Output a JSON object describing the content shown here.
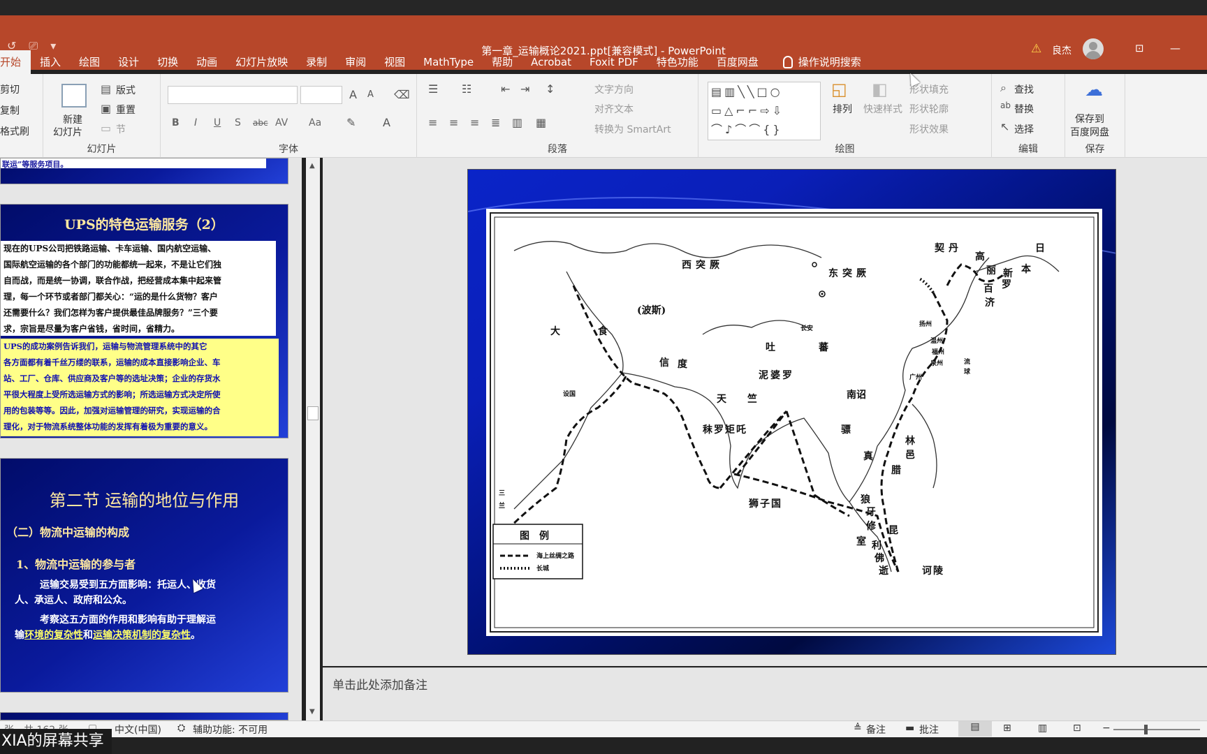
{
  "window": {
    "title": "第一章_运输概论2021.ppt[兼容模式] - PowerPoint",
    "user": "良杰"
  },
  "menu": [
    "开始",
    "插入",
    "绘图",
    "设计",
    "切换",
    "动画",
    "幻灯片放映",
    "录制",
    "审阅",
    "视图",
    "MathType",
    "帮助",
    "Acrobat",
    "Foxit PDF",
    "特色功能",
    "百度网盘"
  ],
  "help_search": "操作说明搜索",
  "ribbon": {
    "clipboard": {
      "cut": "剪切",
      "copy": "复制",
      "painter": "格式刷"
    },
    "slides": {
      "new_slide_1": "新建",
      "new_slide_2": "幻灯片",
      "layout": "版式",
      "reset": "重置",
      "section": "节",
      "label": "幻灯片"
    },
    "font": {
      "label": "字体",
      "bold": "B",
      "italic": "I",
      "underline": "U",
      "shadow": "S",
      "strike": "abc",
      "spacing": "AV",
      "case": "Aa"
    },
    "paragraph": {
      "label": "段落",
      "text_direction": "文字方向",
      "align_text": "对齐文本",
      "smartart": "转换为 SmartArt"
    },
    "drawing": {
      "label": "绘图",
      "arrange": "排列",
      "quick_styles": "快速样式",
      "fill": "形状填充",
      "outline": "形状轮廓",
      "effects": "形状效果"
    },
    "editing": {
      "label": "编辑",
      "find": "查找",
      "replace": "替换",
      "select": "选择"
    },
    "save": {
      "label": "保存",
      "save_to_1": "保存到",
      "save_to_2": "百度网盘"
    }
  },
  "thumbnails": {
    "slide_top_text": "联运”等服务项目。",
    "slide_a": {
      "title": "UPS的特色运输服务（2）",
      "para1": [
        "现在的UPS公司把铁路运输、卡车运输、国内航空运输、",
        "国际航空运输的各个部门的功能都统一起来，不是让它们独",
        "自而战，而是统一协调，联合作战，把经营成本集中起来管",
        "理，每一个环节或者部门都关心：“运的是什么货物？客户",
        "还需要什么？我们怎样为客户提供最佳品牌服务？”三个要",
        "求，宗旨是尽量为客户省钱，省时间，省精力。"
      ],
      "para2": [
        "UPS的成功案例告诉我们，运输与物流管理系统中的其它",
        "各方面都有着千丝万缕的联系，运输的成本直接影响企业、车",
        "站、工厂、仓库、供应商及客户等的选址决策；企业的存货水",
        "平很大程度上受所选运输方式的影响；所选运输方式决定所使",
        "用的包装等等。因此，加强对运输管理的研究，实现运输的合",
        "理化，对于物流系统整体功能的发挥有着极为重要的意义。"
      ]
    },
    "slide_b": {
      "title": "第二节 运输的地位与作用",
      "subtitle": "（二）物流中运输的构成",
      "point": "1、物流中运输的参与者",
      "line1": "运输交易受到五方面影响：托运人、收货",
      "line2": "人、承运人、政府和公众。",
      "line3": "考察这五方面的作用和影响有助于理解运",
      "line4_a": "输",
      "line4_b": "环境的复杂性",
      "line4_c": "和",
      "line4_d": "运输决策机制的复杂性",
      "line4_e": "。"
    }
  },
  "map": {
    "regions": [
      "西突厥",
      "东突厥",
      "契丹",
      "高",
      "丽",
      "新",
      "罗",
      "百",
      "济",
      "日",
      "本",
      "(波斯)",
      "大",
      "食",
      "吐",
      "蕃",
      "信",
      "度",
      "泥婆罗",
      "天",
      "竺",
      "南诏",
      "秣罗矩吒",
      "骠",
      "真",
      "腊",
      "林",
      "邑",
      "狮子国",
      "狼",
      "牙",
      "修",
      "昆",
      "室",
      "利",
      "佛",
      "逝",
      "诃陵"
    ],
    "cities": [
      "长安",
      "扬州",
      "温州",
      "福州",
      "泉州",
      "广州",
      "流",
      "球",
      "设国",
      "三",
      "兰"
    ],
    "legend_title": "图　例",
    "legend_route": "海上丝绸之路",
    "legend_wall": "长城"
  },
  "notes_placeholder": "单击此处添加备注",
  "status": {
    "slide_count": "张　共 162 张",
    "language": "中文(中国)",
    "accessibility": "辅助功能: 不可用",
    "notes_btn": "备注",
    "comments_btn": "批注"
  },
  "share_overlay": "XIA的屏幕共享"
}
